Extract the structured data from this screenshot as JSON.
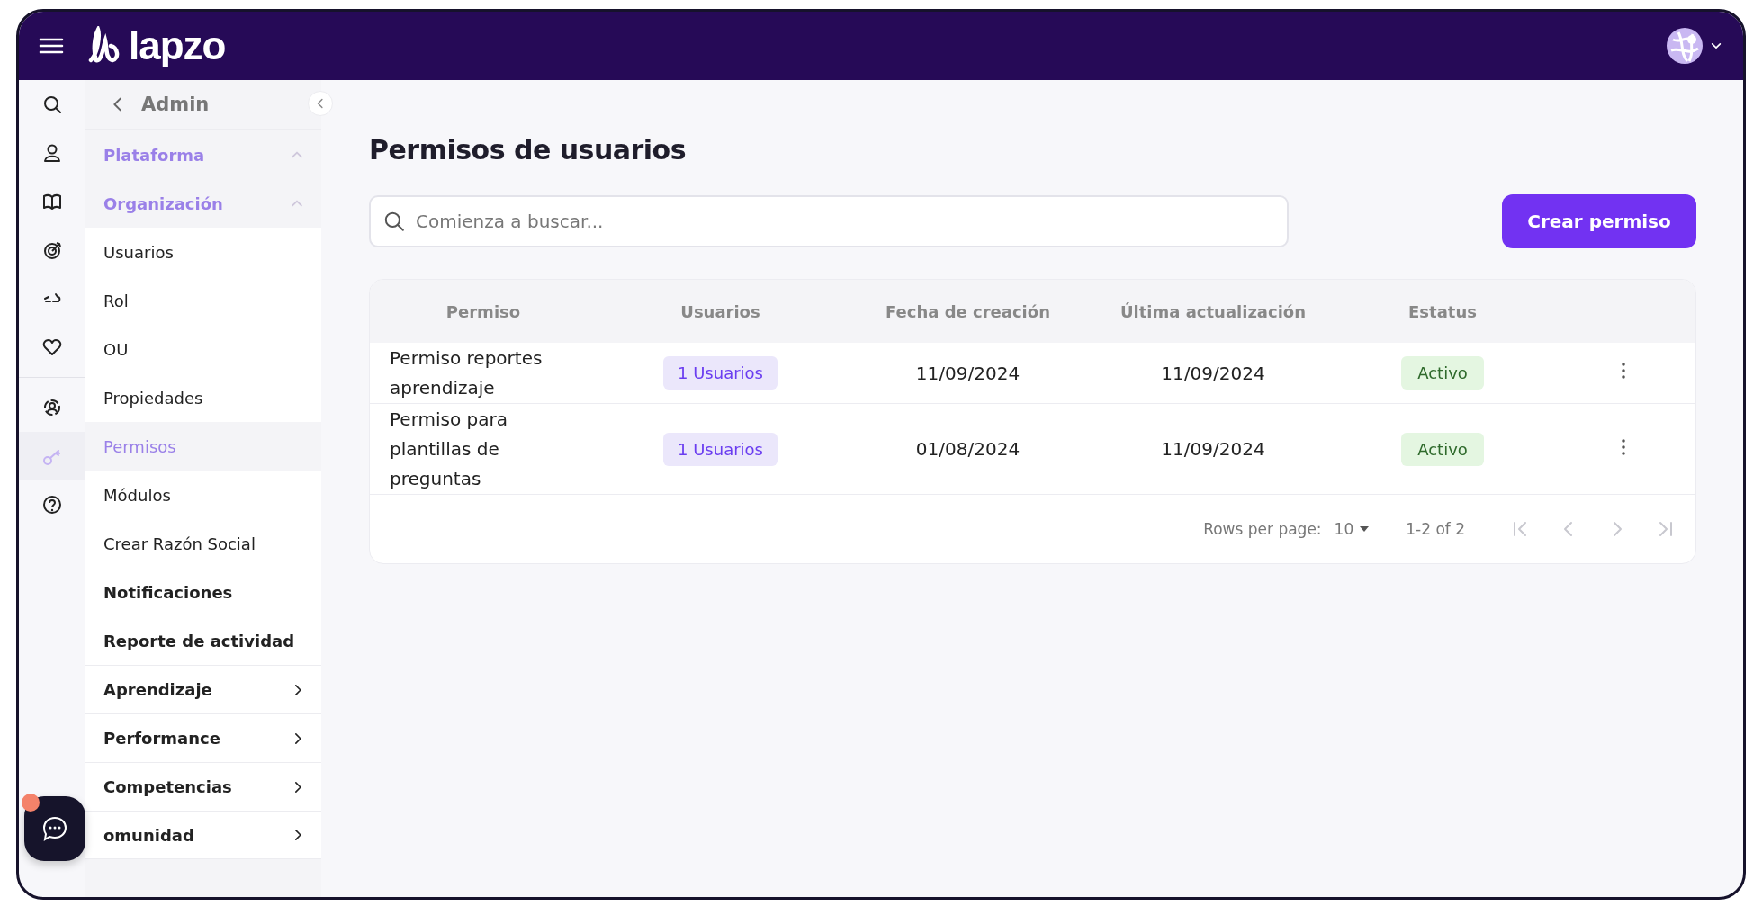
{
  "topbar": {
    "logo": "lapzo"
  },
  "rail": [
    {
      "selected": false
    },
    {
      "selected": false
    },
    {
      "selected": false
    },
    {
      "selected": false
    },
    {
      "selected": false
    },
    {
      "selected": false
    },
    {
      "selected": false
    },
    {
      "selected": true
    },
    {
      "selected": false
    }
  ],
  "submenu": {
    "title": "Admin",
    "items": [
      {
        "kind": "group",
        "label": "Plataforma",
        "expanded": true
      },
      {
        "kind": "group",
        "label": "Organización",
        "expanded": true,
        "children": [
          {
            "label": "Usuarios",
            "selected": false
          },
          {
            "label": "Rol",
            "selected": false
          },
          {
            "label": "OU",
            "selected": false
          },
          {
            "label": "Propiedades",
            "selected": false
          },
          {
            "label": "Permisos",
            "selected": true
          },
          {
            "label": "Módulos",
            "selected": false
          },
          {
            "label": "Crear Razón Social",
            "selected": false
          }
        ]
      },
      {
        "kind": "page",
        "label": "Notificaciones"
      },
      {
        "kind": "page",
        "label": "Reporte de actividad"
      },
      {
        "kind": "submenu",
        "label": "Aprendizaje"
      },
      {
        "kind": "submenu",
        "label": "Performance"
      },
      {
        "kind": "submenu",
        "label": "Competencias"
      },
      {
        "kind": "submenu",
        "label": "omunidad"
      }
    ]
  },
  "main": {
    "title": "Permisos de usuarios",
    "search": {
      "placeholder": "Comienza a buscar..."
    },
    "create_button": "Crear permiso",
    "table": {
      "columns": [
        "Permiso",
        "Usuarios",
        "Fecha de creación",
        "Última actualización",
        "Estatus"
      ],
      "rows": [
        {
          "permiso": "Permiso reportes aprendizaje",
          "usuarios": "1 Usuarios",
          "created": "11/09/2024",
          "updated": "11/09/2024",
          "status": "Activo"
        },
        {
          "permiso": "Permiso para plantillas de preguntas",
          "usuarios": "1 Usuarios",
          "created": "01/08/2024",
          "updated": "11/09/2024",
          "status": "Activo"
        }
      ],
      "footer": {
        "rows_per_page_label": "Rows per page:",
        "rows_per_page": "10",
        "range": "1-2 of 2",
        "pager": [
          {
            "disabled": true
          },
          {
            "disabled": true
          },
          {
            "disabled": true
          },
          {
            "disabled": true
          }
        ]
      }
    }
  },
  "chat": {
    "unread": true
  }
}
